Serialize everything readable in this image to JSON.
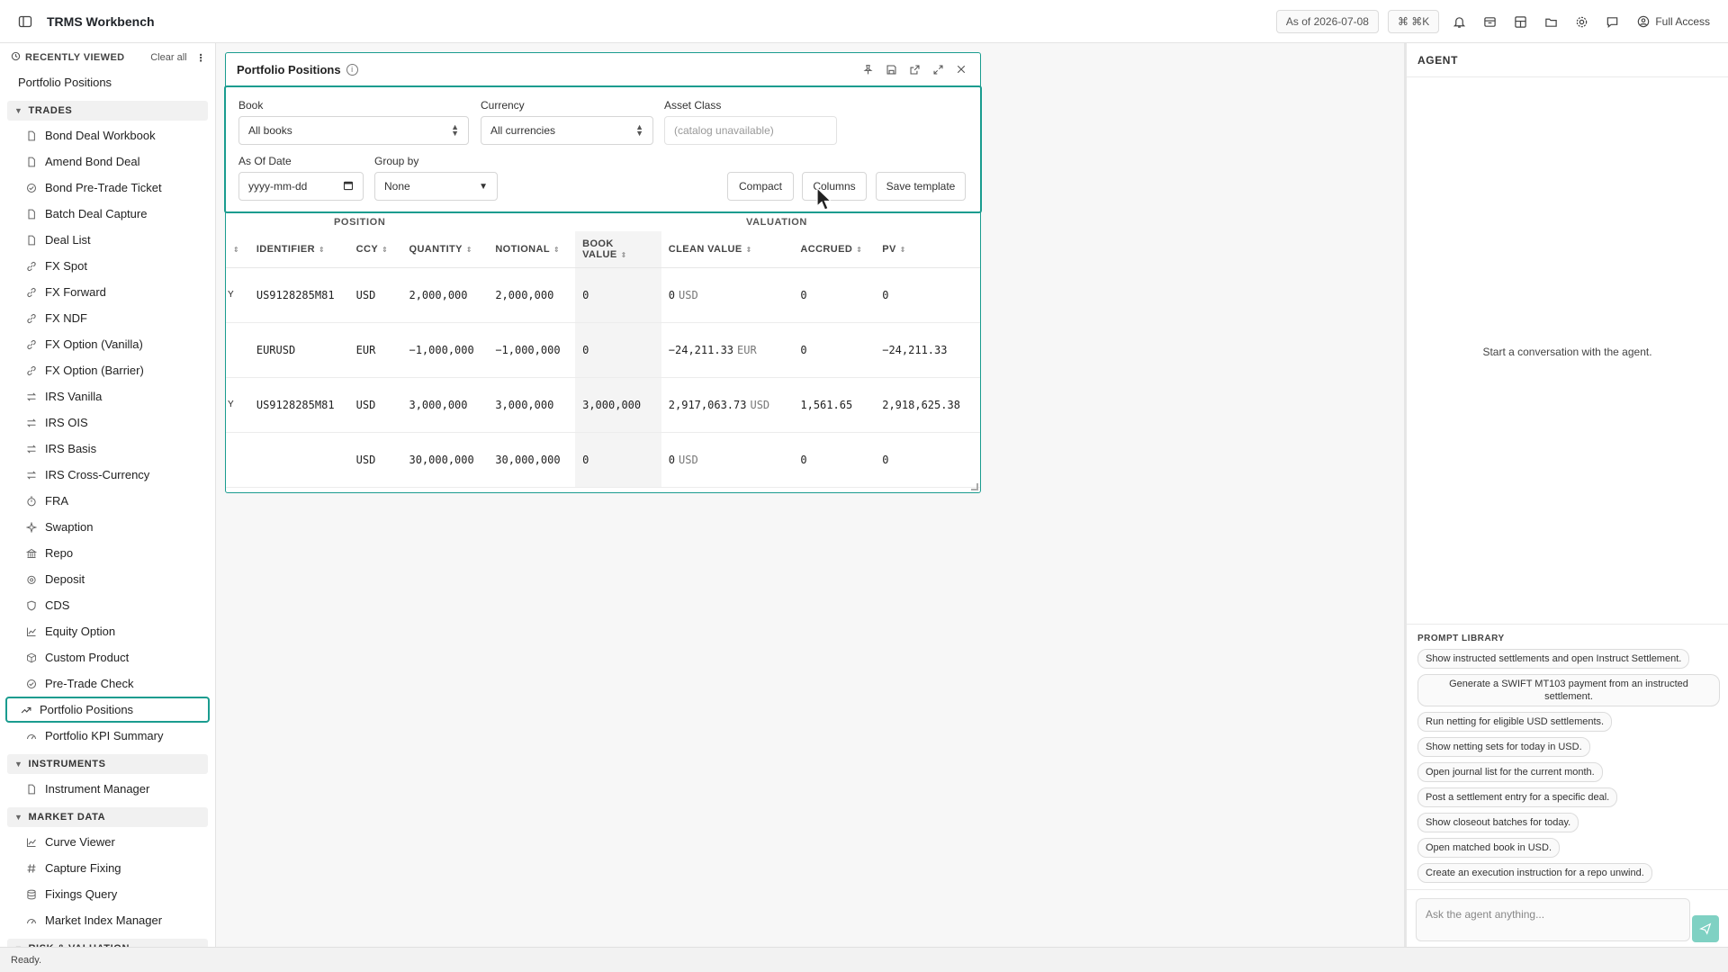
{
  "app": {
    "title": "TRMS Workbench"
  },
  "topbar": {
    "as_of": "As of 2026-07-08",
    "shortcut": "⌘ ⌘K",
    "access": "Full Access"
  },
  "sidebar": {
    "recently_viewed_label": "RECENTLY VIEWED",
    "clear_all": "Clear all",
    "recent": [
      "Portfolio Positions"
    ],
    "sections": [
      {
        "label": "TRADES",
        "items": [
          {
            "label": "Bond Deal Workbook",
            "icon": "document-icon"
          },
          {
            "label": "Amend Bond Deal",
            "icon": "document-icon"
          },
          {
            "label": "Bond Pre-Trade Ticket",
            "icon": "check-circle-icon"
          },
          {
            "label": "Batch Deal Capture",
            "icon": "document-icon"
          },
          {
            "label": "Deal List",
            "icon": "document-icon"
          },
          {
            "label": "FX Spot",
            "icon": "link-icon"
          },
          {
            "label": "FX Forward",
            "icon": "link-icon"
          },
          {
            "label": "FX NDF",
            "icon": "link-icon"
          },
          {
            "label": "FX Option (Vanilla)",
            "icon": "link-icon"
          },
          {
            "label": "FX Option (Barrier)",
            "icon": "link-icon"
          },
          {
            "label": "IRS Vanilla",
            "icon": "swap-icon"
          },
          {
            "label": "IRS OIS",
            "icon": "swap-icon"
          },
          {
            "label": "IRS Basis",
            "icon": "swap-icon"
          },
          {
            "label": "IRS Cross-Currency",
            "icon": "swap-icon"
          },
          {
            "label": "FRA",
            "icon": "timer-icon"
          },
          {
            "label": "Swaption",
            "icon": "sparkle-icon"
          },
          {
            "label": "Repo",
            "icon": "bank-icon"
          },
          {
            "label": "Deposit",
            "icon": "piggy-bank-icon"
          },
          {
            "label": "CDS",
            "icon": "shield-icon"
          },
          {
            "label": "Equity Option",
            "icon": "line-chart-icon"
          },
          {
            "label": "Custom Product",
            "icon": "box-icon"
          },
          {
            "label": "Pre-Trade Check",
            "icon": "check-circle-icon"
          },
          {
            "label": "Portfolio Positions",
            "icon": "trend-up-icon",
            "active": true
          },
          {
            "label": "Portfolio KPI Summary",
            "icon": "gauge-icon"
          }
        ]
      },
      {
        "label": "INSTRUMENTS",
        "items": [
          {
            "label": "Instrument Manager",
            "icon": "document-icon"
          }
        ]
      },
      {
        "label": "MARKET DATA",
        "items": [
          {
            "label": "Curve Viewer",
            "icon": "line-chart-icon"
          },
          {
            "label": "Capture Fixing",
            "icon": "hash-icon"
          },
          {
            "label": "Fixings Query",
            "icon": "database-icon"
          },
          {
            "label": "Market Index Manager",
            "icon": "gauge-icon"
          }
        ]
      },
      {
        "label": "RISK & VALUATION",
        "items": []
      }
    ]
  },
  "panel": {
    "title": "Portfolio Positions",
    "filters": {
      "book_label": "Book",
      "book_value": "All books",
      "currency_label": "Currency",
      "currency_value": "All currencies",
      "asset_class_label": "Asset Class",
      "asset_class_placeholder": "(catalog unavailable)",
      "as_of_label": "As Of Date",
      "as_of_placeholder": "yyyy-mm-dd",
      "group_by_label": "Group by",
      "group_by_value": "None",
      "compact": "Compact",
      "columns": "Columns",
      "save_template": "Save template"
    },
    "groups": {
      "position": "POSITION",
      "valuation": "VALUATION"
    },
    "columns": [
      "IDENTIFIER",
      "CCY",
      "QUANTITY",
      "NOTIONAL",
      "BOOK VALUE",
      "CLEAN VALUE",
      "ACCRUED",
      "PV"
    ],
    "rows": [
      {
        "edge": "Y",
        "identifier": "US9128285M81",
        "ccy": "USD",
        "quantity": "2,000,000",
        "notional": "2,000,000",
        "book_value": "0",
        "clean_value": "0",
        "clean_ccy": "USD",
        "accrued": "0",
        "pv": "0"
      },
      {
        "edge": "",
        "identifier": "EURUSD",
        "ccy": "EUR",
        "quantity": "−1,000,000",
        "notional": "−1,000,000",
        "book_value": "0",
        "clean_value": "−24,211.33",
        "clean_ccy": "EUR",
        "accrued": "0",
        "pv": "−24,211.33"
      },
      {
        "edge": "Y",
        "identifier": "US9128285M81",
        "ccy": "USD",
        "quantity": "3,000,000",
        "notional": "3,000,000",
        "book_value": "3,000,000",
        "clean_value": "2,917,063.73",
        "clean_ccy": "USD",
        "accrued": "1,561.65",
        "pv": "2,918,625.38"
      },
      {
        "edge": "",
        "identifier": "",
        "ccy": "USD",
        "quantity": "30,000,000",
        "notional": "30,000,000",
        "book_value": "0",
        "clean_value": "0",
        "clean_ccy": "USD",
        "accrued": "0",
        "pv": "0"
      }
    ]
  },
  "agent": {
    "title": "AGENT",
    "empty": "Start a conversation with the agent.",
    "prompt_library_title": "PROMPT LIBRARY",
    "prompts": [
      "Show instructed settlements and open Instruct Settlement.",
      "Generate a SWIFT MT103 payment from an instructed settlement.",
      "Run netting for eligible USD settlements.",
      "Show netting sets for today in USD.",
      "Open journal list for the current month.",
      "Post a settlement entry for a specific deal.",
      "Show closeout batches for today.",
      "Open matched book in USD.",
      "Create an execution instruction for a repo unwind."
    ],
    "input_placeholder": "Ask the agent anything..."
  },
  "status": {
    "text": "Ready."
  },
  "colors": {
    "accent": "#1a9c8f",
    "send_button": "#7fd1c3"
  }
}
